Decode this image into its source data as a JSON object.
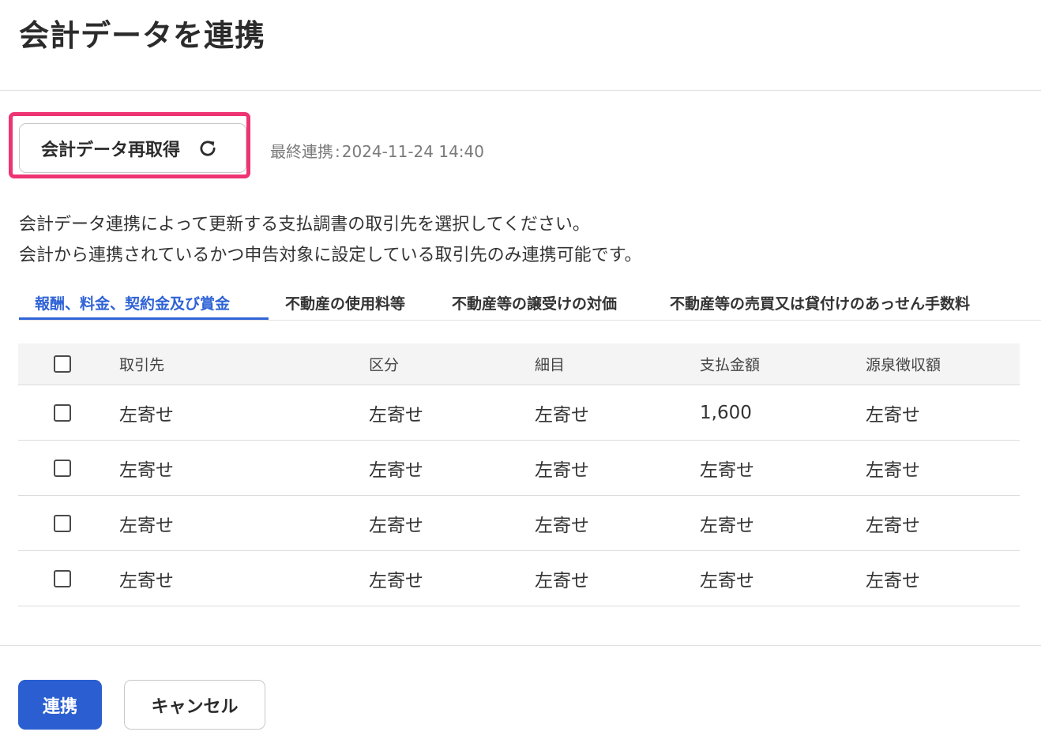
{
  "page": {
    "title": "会計データを連携"
  },
  "sync": {
    "refetch_label": "会計データ再取得",
    "last_sync_label": "最終連携",
    "last_sync_separator": ":",
    "last_sync_value": "2024-11-24 14:40"
  },
  "description": {
    "line1": "会計データ連携によって更新する支払調書の取引先を選択してください。",
    "line2": "会計から連携されているかつ申告対象に設定している取引先のみ連携可能です。"
  },
  "tabs": [
    {
      "label": "報酬、料金、契約金及び賞金",
      "active": true
    },
    {
      "label": "不動産の使用料等",
      "active": false
    },
    {
      "label": "不動産等の譲受けの対価",
      "active": false
    },
    {
      "label": "不動産等の売買又は貸付けのあっせん手数料",
      "active": false
    }
  ],
  "table": {
    "headers": [
      "取引先",
      "区分",
      "細目",
      "支払金額",
      "源泉徴収額"
    ],
    "rows": [
      [
        "左寄せ",
        "左寄せ",
        "左寄せ",
        "1,600",
        "左寄せ"
      ],
      [
        "左寄せ",
        "左寄せ",
        "左寄せ",
        "左寄せ",
        "左寄せ"
      ],
      [
        "左寄せ",
        "左寄せ",
        "左寄せ",
        "左寄せ",
        "左寄せ"
      ],
      [
        "左寄せ",
        "左寄せ",
        "左寄せ",
        "左寄せ",
        "左寄せ"
      ]
    ]
  },
  "footer": {
    "primary_label": "連携",
    "cancel_label": "キャンセル"
  },
  "colors": {
    "accent": "#2f63d6",
    "primary_button": "#2b5fd1",
    "highlight": "#ee3472"
  },
  "icons": {
    "refetch": "refresh-icon"
  }
}
